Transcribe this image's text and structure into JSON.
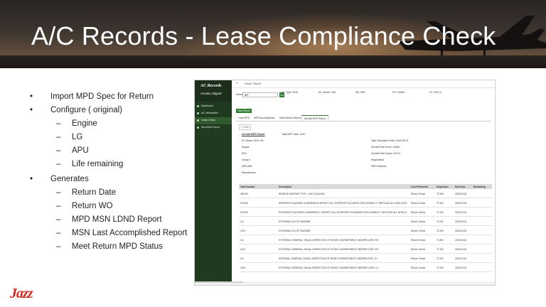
{
  "slide": {
    "title": "A/C Records - Lease Compliance Check",
    "logo": "Jazz",
    "bullets": [
      {
        "text": "Import MPD Spec for Return",
        "sub": []
      },
      {
        "text": "Configure ( original)",
        "sub": [
          "Engine",
          "LG",
          "APU",
          "Life remaining"
        ]
      },
      {
        "text": "Generates",
        "sub": [
          "Return Date",
          "Return WO",
          "MPD MSN LDND Report",
          "MSN Last Accomplished Report",
          "Meet Return MPD Status"
        ]
      }
    ],
    "bullet_glyph": "•",
    "dash_glyph": "–"
  },
  "app": {
    "brand": "AC Records",
    "user": "Acosta, Miguel",
    "nav": [
      "Dashboard",
      "A/C Information",
      "Lease Check",
      "Spec2000 Export"
    ],
    "active_nav": 2,
    "menu_icon": "hamburger-icon",
    "breadcrumb": "Home / Report",
    "filters": {
      "aircraft_label": "Aircraft",
      "aircraft_value": "507",
      "go": "Go",
      "ac_type": "AC Type: DHC",
      "ac_series": "AC Series: 100",
      "sn": "SN: 955",
      "fh": "FH: 41845",
      "fc": "FC: 60174"
    },
    "new_report": "New Report",
    "tabs": [
      "Load MPD",
      "MPD Accomplished",
      "Meet Return Report",
      "Aircraft MPD Report"
    ],
    "active_tab": 3,
    "print": "Print",
    "report": {
      "heading": "Aircraft MPD Report",
      "total": "Total MPD Task: 1494",
      "left": [
        "AC Model: DHC-100",
        "Engine",
        "APU",
        "Group #",
        "MSN-308",
        "Manufacturer"
      ],
      "right": [
        "Take Calculation Date: 2016-09-02",
        "Aircraft Total Hours: 41845",
        "Aircraft Total Cycles: 60174",
        "Registration",
        "MPD Revision"
      ]
    },
    "grid": {
      "columns": [
        "Task Number",
        "Description",
        "Last Performed",
        "Inspection",
        "Next Due",
        "Remaining"
      ],
      "rows": [
        [
          "082100",
          "RENEGE AIRCRAFT STR - DHC-8-100/300",
          "Return Check",
          "T2-HD",
          "2022/12/31",
          ""
        ],
        [
          "220100",
          "INTERIOR PLACARDS & MARKINGS INSPECT ALL INTERIOR PLACARDS FOR LEGIBILITY. REPLACE ALL NON-LEGIBLE PLACARDS",
          "Return Check",
          "T2-HD",
          "2022/12/31",
          ""
        ],
        [
          "220100",
          "EXTERIOR PLACARDS & MARKINGS - INSPECT ALL EXTERIOR PLACARDS FOR LEGIBILITY. REPLACE ALL NON-LEGIBLE PLACARDS",
          "Return Check",
          "T2-HD",
          "2022/12/31",
          ""
        ],
        [
          "111",
          "EXTERNAL DVI OF RADOME",
          "Return Check",
          "T2-HD",
          "2022/12/31",
          ""
        ],
        [
          "1110",
          "EXTERNAL DVI OF RADOME",
          "Return Check",
          "T2-HD",
          "2022/12/31",
          ""
        ],
        [
          "111",
          "EXTERNAL GENERAL VISUAL INSPECTION OF NOSE COMPARTMENT UNDERFLOOR, RH",
          "Return Check",
          "T2-HD",
          "2022/12/31",
          ""
        ],
        [
          "1120",
          "EXTERNAL GENERAL VISUAL INSPECTION OF NOSE COMPARTMENT UNDERFLOOR, RH",
          "Return Check",
          "T2-HD",
          "2022/12/31",
          ""
        ],
        [
          "111",
          "INTERNAL GENERAL VISUAL INSPECTION OF NOSE COMPARTMENT UNDERFLOOR, LH",
          "Return Check",
          "T2-HD",
          "2022/12/31",
          ""
        ],
        [
          "1130",
          "EXTERNAL GENERAL VISUAL INSPECTION OF NOSE COMPARTMENT UNDERFLOOR, LH",
          "Return Check",
          "T2-HD",
          "2022/12/31",
          ""
        ]
      ]
    },
    "status_bar": "localhost:8080/Lease/Report/AircraftMPDReport?msn=308"
  }
}
